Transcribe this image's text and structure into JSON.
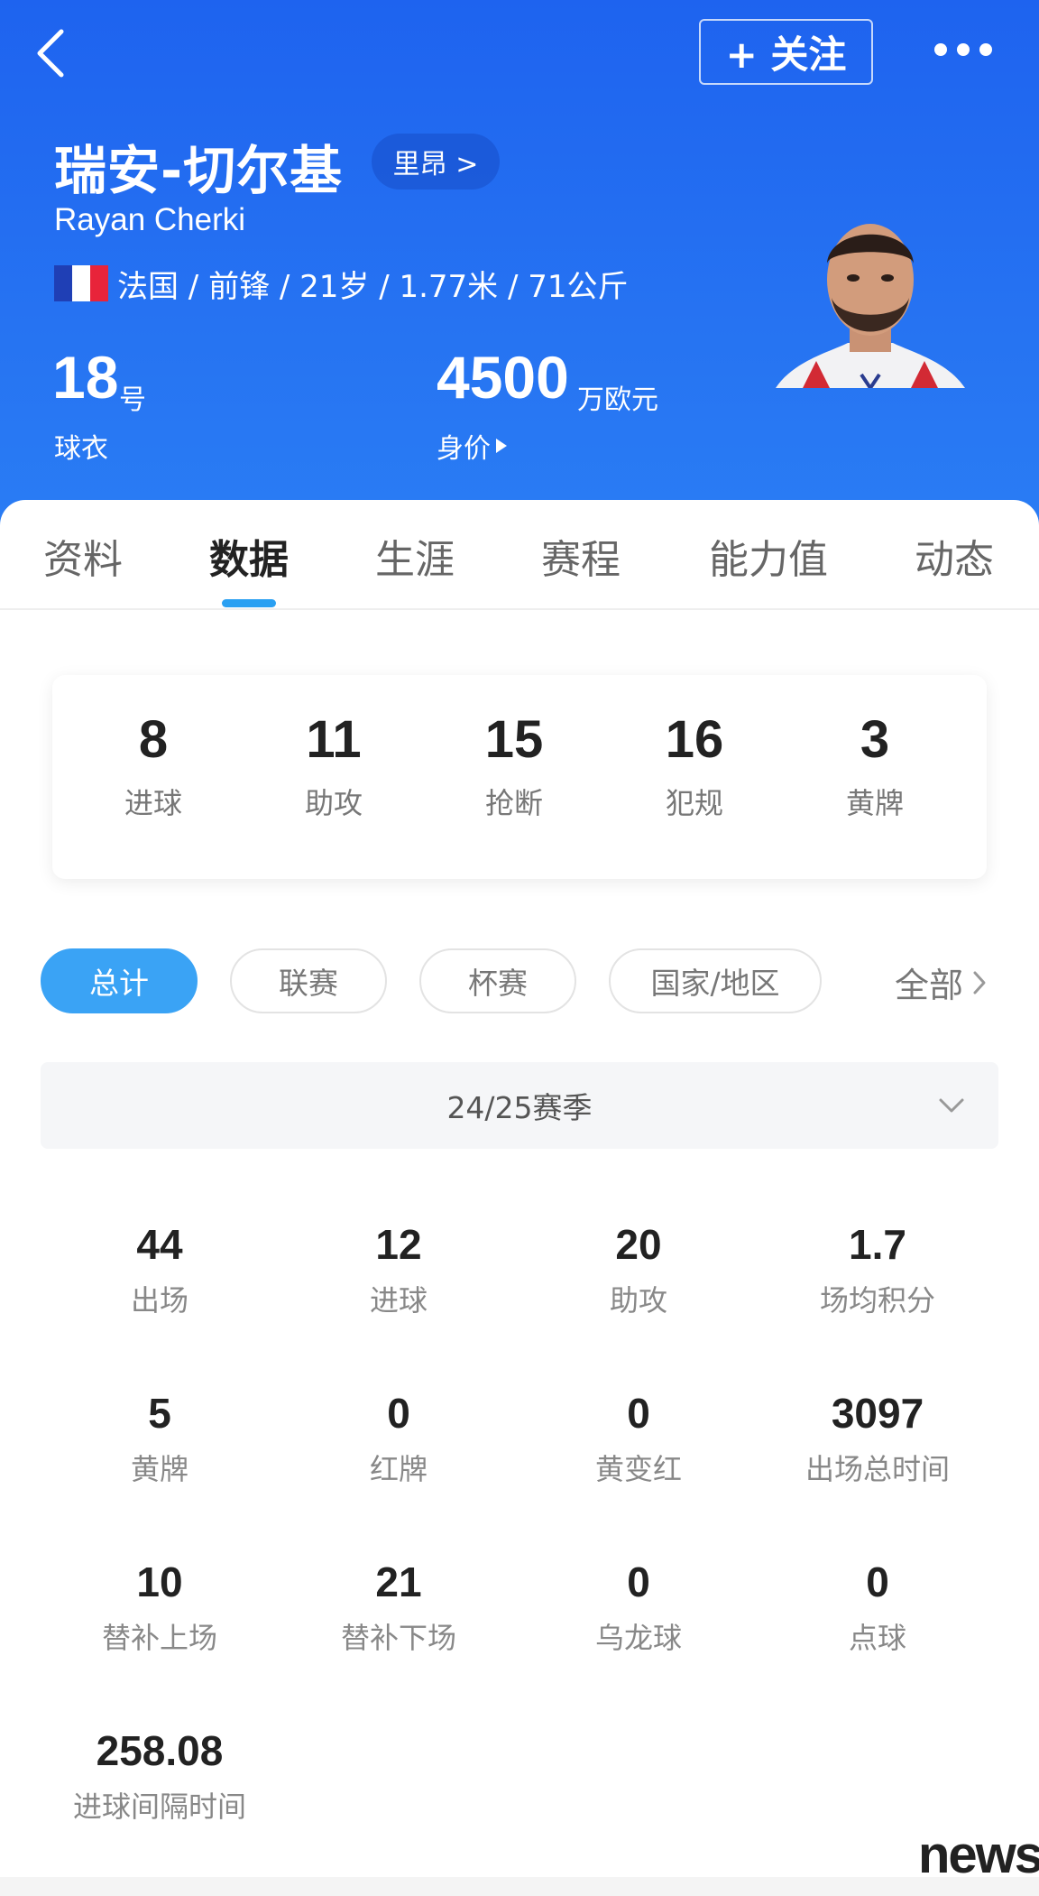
{
  "header": {
    "follow_label": "+ 关注",
    "player_name": "瑞安-切尔基",
    "club": "里昂 >",
    "name_en": "Rayan Cherki",
    "flag_colors": [
      "#1f3fb5",
      "#ffffff",
      "#e8243a"
    ],
    "info": "法国 / 前锋 / 21岁 / 1.77米 / 71公斤",
    "shirt": {
      "number": "18",
      "unit": "号",
      "label": "球衣"
    },
    "value": {
      "amount": "4500",
      "unit": "万欧元",
      "label": "身价"
    }
  },
  "tabs": [
    {
      "label": "资料",
      "active": false
    },
    {
      "label": "数据",
      "active": true
    },
    {
      "label": "生涯",
      "active": false
    },
    {
      "label": "赛程",
      "active": false
    },
    {
      "label": "能力值",
      "active": false
    },
    {
      "label": "动态",
      "active": false
    }
  ],
  "summary": [
    {
      "value": "8",
      "label": "进球"
    },
    {
      "value": "11",
      "label": "助攻"
    },
    {
      "value": "15",
      "label": "抢断"
    },
    {
      "value": "16",
      "label": "犯规"
    },
    {
      "value": "3",
      "label": "黄牌"
    }
  ],
  "filters": [
    {
      "label": "总计",
      "active": true
    },
    {
      "label": "联赛",
      "active": false
    },
    {
      "label": "杯赛",
      "active": false
    },
    {
      "label": "国家/地区",
      "active": false
    }
  ],
  "filter_all": "全部",
  "season": "24/25赛季",
  "stats": [
    {
      "value": "44",
      "label": "出场"
    },
    {
      "value": "12",
      "label": "进球"
    },
    {
      "value": "20",
      "label": "助攻"
    },
    {
      "value": "1.7",
      "label": "场均积分"
    },
    {
      "value": "5",
      "label": "黄牌"
    },
    {
      "value": "0",
      "label": "红牌"
    },
    {
      "value": "0",
      "label": "黄变红"
    },
    {
      "value": "3097",
      "label": "出场总时间"
    },
    {
      "value": "10",
      "label": "替补上场"
    },
    {
      "value": "21",
      "label": "替补下场"
    },
    {
      "value": "0",
      "label": "乌龙球"
    },
    {
      "value": "0",
      "label": "点球"
    },
    {
      "value": "258.08",
      "label": "进球间隔时间"
    }
  ],
  "watermark": "news",
  "accent": "#3aa3f5",
  "header_color": "#1e63ef"
}
